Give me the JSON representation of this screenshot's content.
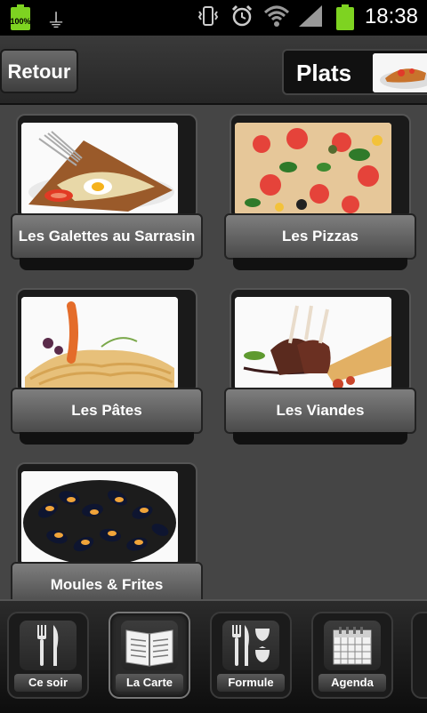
{
  "status": {
    "battery_left_pct": "100%",
    "time": "18:38"
  },
  "header": {
    "back_label": "Retour",
    "title": "Plats"
  },
  "cards": [
    {
      "label": "Les Galettes au Sarrasin"
    },
    {
      "label": "Les Pizzas"
    },
    {
      "label": "Les Pâtes"
    },
    {
      "label": "Les Viandes"
    },
    {
      "label": "Moules & Frites"
    }
  ],
  "tabs": [
    {
      "label": "Ce soir",
      "icon": "cutlery-icon"
    },
    {
      "label": "La Carte",
      "icon": "menu-book-icon",
      "active": true
    },
    {
      "label": "Formule",
      "icon": "cutlery-wine-icon"
    },
    {
      "label": "Agenda",
      "icon": "calendar-icon"
    }
  ],
  "colors": {
    "header_bg": "#2e2e2e",
    "content_bg": "#454545",
    "battery": "#7ed321"
  }
}
